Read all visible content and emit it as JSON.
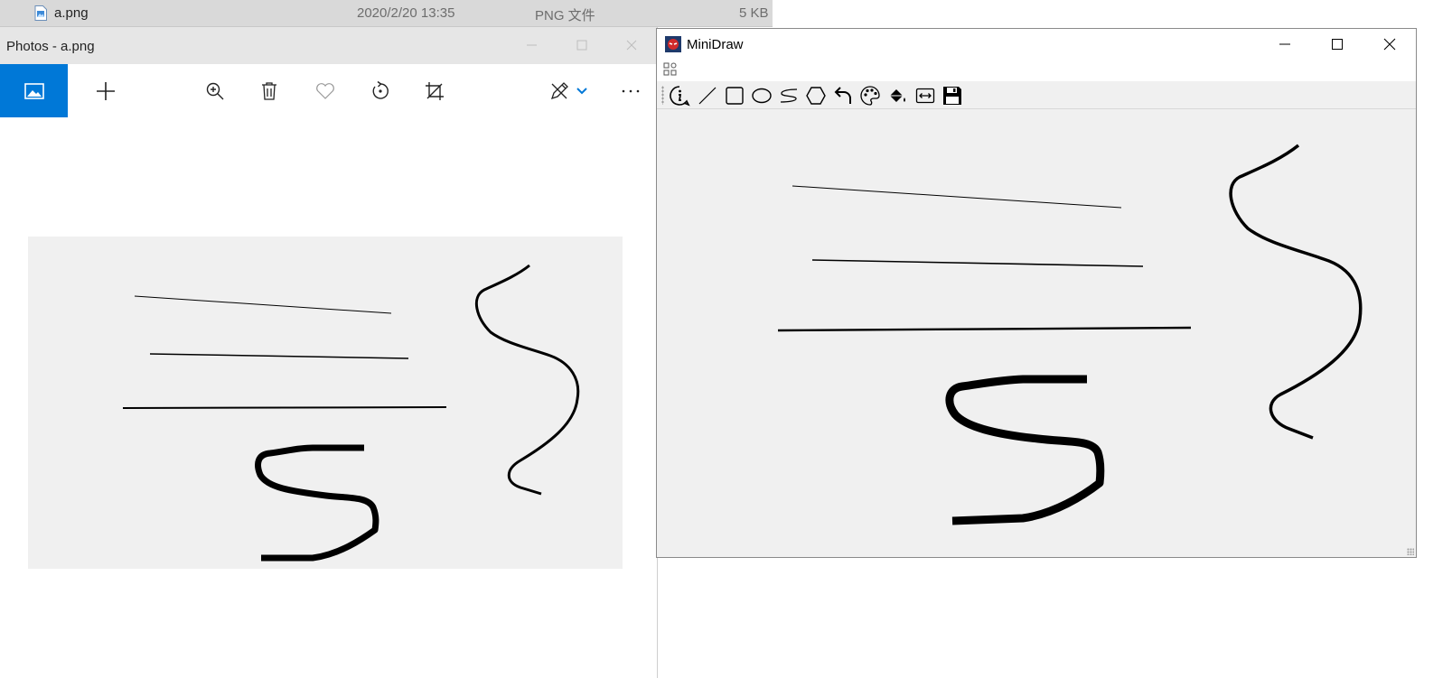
{
  "explorer": {
    "file_name": "a.png",
    "date_modified": "2020/2/20 13:35",
    "file_type": "PNG 文件",
    "file_size": "5 KB",
    "file_icon": "png-file-icon"
  },
  "photos": {
    "title": "Photos - a.png",
    "window_buttons": [
      "minimize-icon",
      "maximize-icon",
      "close-icon"
    ],
    "toolbar": [
      "see-all-photos-icon",
      "add-icon",
      "zoom-icon",
      "delete-icon",
      "favorite-icon",
      "rotate-icon",
      "crop-icon",
      "edit-create-icon",
      "chevron-down-icon",
      "more-options-icon"
    ],
    "accent_color": "#0078d7"
  },
  "minidraw": {
    "title": "MiniDraw",
    "window_buttons": [
      "minimize-icon",
      "maximize-icon",
      "close-icon"
    ],
    "menu_icon": "menu-grid-icon",
    "tools": [
      "about-info-icon",
      "line-tool-icon",
      "rectangle-tool-icon",
      "ellipse-tool-icon",
      "freehand-tool-icon",
      "polygon-tool-icon",
      "undo-icon",
      "palette-icon",
      "fill-bucket-icon",
      "width-icon",
      "save-icon"
    ],
    "canvas_background": "#f0f0f0",
    "stroke_color": "#000000"
  }
}
